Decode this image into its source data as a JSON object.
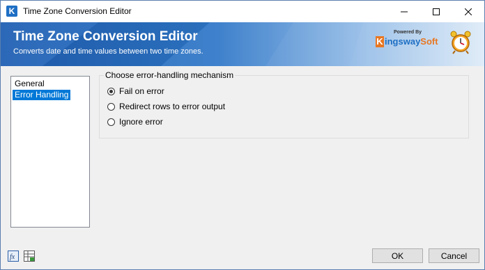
{
  "window": {
    "title": "Time Zone Conversion Editor",
    "app_icon": "K",
    "controls": [
      "minimize-icon",
      "maximize-icon",
      "close-icon"
    ]
  },
  "banner": {
    "title": "Time Zone Conversion Editor",
    "subtitle": "Converts date and time values between two time zones.",
    "logo_powered_by": "Powered By",
    "logo_k": "K",
    "logo_ingsway": "ingsway",
    "logo_soft": "Soft",
    "clock_icon": "alarm-clock-icon"
  },
  "nav": {
    "items": [
      {
        "label": "General",
        "selected": false
      },
      {
        "label": "Error Handling",
        "selected": true
      }
    ]
  },
  "error_handling": {
    "group_label": "Choose error-handling mechanism",
    "options": [
      {
        "label": "Fail on error",
        "checked": true
      },
      {
        "label": "Redirect rows to error output",
        "checked": false
      },
      {
        "label": "Ignore error",
        "checked": false
      }
    ]
  },
  "footer": {
    "icons": [
      "expression-fx-icon",
      "variables-grid-icon"
    ],
    "ok_label": "OK",
    "cancel_label": "Cancel"
  },
  "colors": {
    "banner_start": "#1f5fb3",
    "selection": "#0078d7",
    "logo_orange": "#e87722",
    "logo_blue": "#1e6fc4"
  }
}
